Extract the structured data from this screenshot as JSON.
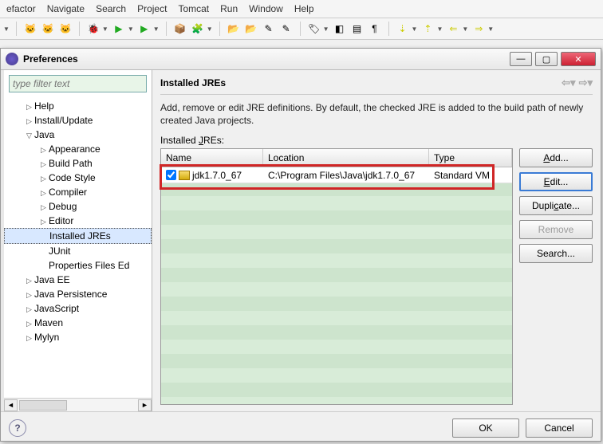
{
  "menu": [
    "efactor",
    "Navigate",
    "Search",
    "Project",
    "Tomcat",
    "Run",
    "Window",
    "Help"
  ],
  "dialog": {
    "title": "Preferences",
    "filter_placeholder": "type filter text",
    "tree": [
      {
        "label": "Help",
        "lvl": 1,
        "caret": "▷"
      },
      {
        "label": "Install/Update",
        "lvl": 1,
        "caret": "▷"
      },
      {
        "label": "Java",
        "lvl": 1,
        "caret": "▽"
      },
      {
        "label": "Appearance",
        "lvl": 2,
        "caret": "▷"
      },
      {
        "label": "Build Path",
        "lvl": 2,
        "caret": "▷"
      },
      {
        "label": "Code Style",
        "lvl": 2,
        "caret": "▷"
      },
      {
        "label": "Compiler",
        "lvl": 2,
        "caret": "▷"
      },
      {
        "label": "Debug",
        "lvl": 2,
        "caret": "▷"
      },
      {
        "label": "Editor",
        "lvl": 2,
        "caret": "▷"
      },
      {
        "label": "Installed JREs",
        "lvl": 2,
        "caret": "",
        "selected": true
      },
      {
        "label": "JUnit",
        "lvl": 2,
        "caret": ""
      },
      {
        "label": "Properties Files Ed",
        "lvl": 2,
        "caret": ""
      },
      {
        "label": "Java EE",
        "lvl": 1,
        "caret": "▷"
      },
      {
        "label": "Java Persistence",
        "lvl": 1,
        "caret": "▷"
      },
      {
        "label": "JavaScript",
        "lvl": 1,
        "caret": "▷"
      },
      {
        "label": "Maven",
        "lvl": 1,
        "caret": "▷"
      },
      {
        "label": "Mylyn",
        "lvl": 1,
        "caret": "▷"
      }
    ],
    "page": {
      "title": "Installed JREs",
      "desc": "Add, remove or edit JRE definitions. By default, the checked JRE is added to the build path of newly created Java projects.",
      "table_label_pre": "Installed ",
      "table_label_u": "J",
      "table_label_post": "REs:",
      "columns": {
        "name": "Name",
        "location": "Location",
        "type": "Type"
      },
      "rows": [
        {
          "checked": true,
          "name": "jdk1.7.0_67",
          "location": "C:\\Program Files\\Java\\jdk1.7.0_67",
          "type": "Standard VM"
        }
      ],
      "buttons": {
        "add": "Add...",
        "edit": "Edit...",
        "duplicate": "Duplicate...",
        "remove": "Remove",
        "search": "Search..."
      }
    },
    "footer": {
      "ok": "OK",
      "cancel": "Cancel"
    }
  }
}
